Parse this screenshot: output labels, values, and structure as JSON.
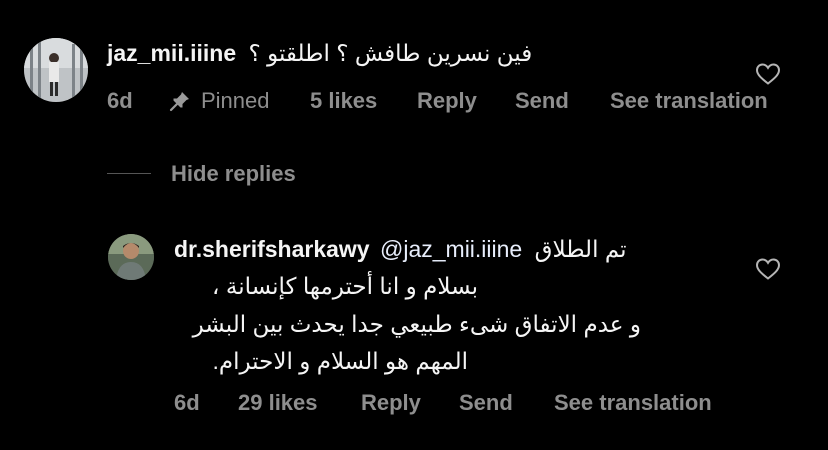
{
  "comment": {
    "username": "jaz_mii.iiine",
    "text": "فين نسرين طافش ؟ اطلقتو ؟",
    "meta": {
      "time": "6d",
      "pinned": "Pinned",
      "likes": "5 likes",
      "reply": "Reply",
      "send": "Send",
      "translate": "See translation"
    }
  },
  "replies_toggle": "Hide replies",
  "reply": {
    "username": "dr.sherifsharkawy",
    "mention": "@jaz_mii.iiine",
    "line1": "تم الطلاق",
    "line2": "بسلام و انا أحترمها كإنسانة ،",
    "line3": "و عدم الاتفاق شىء طبيعي جدا يحدث بين البشر",
    "line4": "المهم هو السلام و الاحترام.",
    "meta": {
      "time": "6d",
      "likes": "29 likes",
      "reply": "Reply",
      "send": "Send",
      "translate": "See translation"
    }
  },
  "colors": {
    "background": "#000000",
    "text": "#f5f5f5",
    "meta": "#8e8e8e"
  }
}
